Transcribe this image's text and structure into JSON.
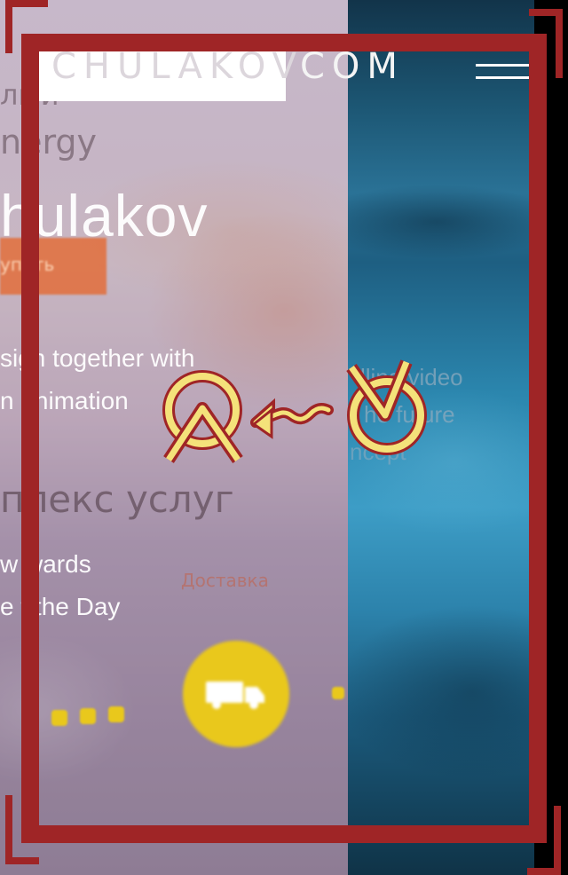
{
  "header": {
    "logo_part1": "CHULAKOV",
    "logo_part2": "COM",
    "menu_icon": "hamburger-menu-icon"
  },
  "hero": {
    "title_fragment": "hulakov",
    "line1": "sign together with",
    "line2": "n  animation",
    "services": "плекс услуг",
    "awards1": "w  wards",
    "awards2": "e  f the Day",
    "top1": "лыи",
    "top2": "nergy",
    "orange_button": "упить",
    "delivery": "Доставка"
  },
  "video": {
    "line1": "lling video",
    "line2": "he future",
    "line3": "ncept"
  },
  "overlay": {
    "gesture": "swipe-left-gesture-icon",
    "frame_color": "#9f2526",
    "accent_yellow": "#f4e27a"
  }
}
